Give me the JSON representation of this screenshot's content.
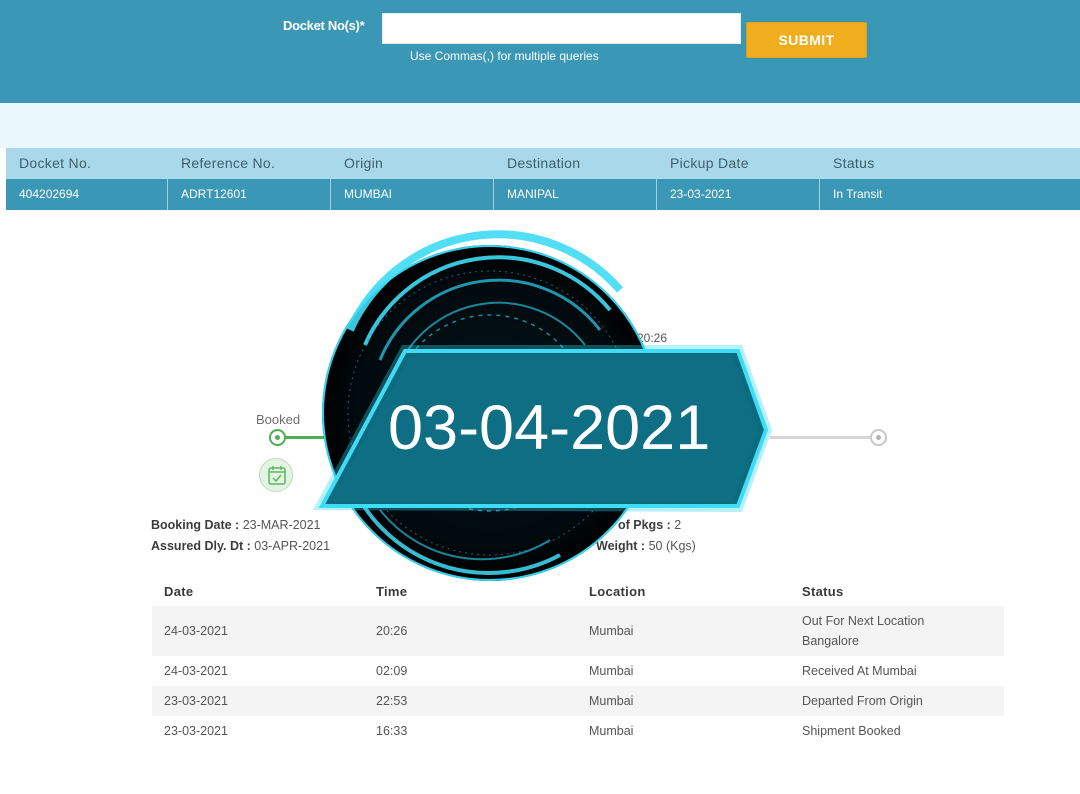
{
  "search": {
    "label": "Docket No(s)*",
    "input_value": "",
    "input_placeholder": "",
    "hint": "Use Commas(,) for multiple queries",
    "submit_label": "SUBMIT"
  },
  "results": {
    "headers": [
      "Docket No.",
      "Reference No.",
      "Origin",
      "Destination",
      "Pickup Date",
      "Status"
    ],
    "row": [
      "404202694",
      "ADRT12601",
      "MUMBAI",
      "MANIPAL",
      "23-03-2021",
      "In Transit"
    ]
  },
  "tracker": {
    "start_label": "Booked",
    "partial_time": "20:26"
  },
  "shipment_info": {
    "booking_date_label": "Booking Date :",
    "booking_date_value": "23-MAR-2021",
    "assured_label": "Assured Dly. Dt :",
    "assured_value": "03-APR-2021",
    "pkgs_label": "of Pkgs :",
    "pkgs_value": "2",
    "weight_label": "Weight :",
    "weight_value": "50 (Kgs)"
  },
  "history": {
    "headers": [
      "Date",
      "Time",
      "Location",
      "Status"
    ],
    "rows": [
      {
        "date": "24-03-2021",
        "time": "20:26",
        "location": "Mumbai",
        "status_line1": "Out For Next Location",
        "status_line2": "Bangalore"
      },
      {
        "date": "24-03-2021",
        "time": "02:09",
        "location": "Mumbai",
        "status_line1": "Received At Mumbai",
        "status_line2": ""
      },
      {
        "date": "23-03-2021",
        "time": "22:53",
        "location": "Mumbai",
        "status_line1": "Departed From Origin",
        "status_line2": ""
      },
      {
        "date": "23-03-2021",
        "time": "16:33",
        "location": "Mumbai",
        "status_line1": "Shipment Booked",
        "status_line2": ""
      }
    ]
  },
  "overlay": {
    "date_text": "03-04-2021"
  },
  "colors": {
    "brand_blue": "#3a98b6",
    "header_light_blue": "#a8d8ea",
    "submit_orange": "#f0ad1d",
    "progress_green": "#4cb050",
    "overlay_teal": "#0d6b80",
    "overlay_glow": "#3fdcf5"
  }
}
